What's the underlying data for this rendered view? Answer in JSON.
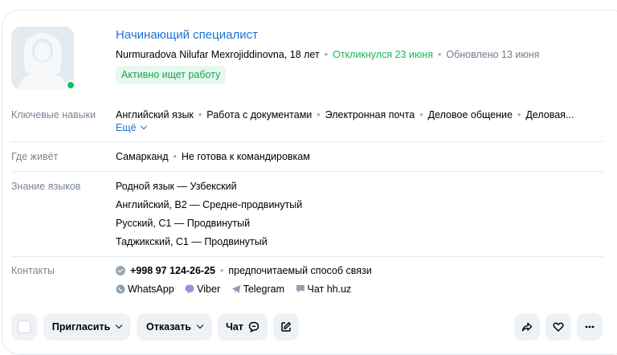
{
  "header": {
    "title": "Начинающий специалист",
    "name_age": "Nurmuradova Nilufar Mexrojiddinovna, 18 лет",
    "responded": "Откликнулся 23 июня",
    "updated": "Обновлено 13 июня",
    "status_badge": "Активно ищет работу"
  },
  "skills": {
    "label": "Ключевые навыки",
    "items": [
      "Английский язык",
      "Работа с документами",
      "Электронная почта",
      "Деловое общение",
      "Деловая..."
    ],
    "more_label": "Ещё"
  },
  "location": {
    "label": "Где живёт",
    "city": "Самарканд",
    "travel": "Не готова к командировкам"
  },
  "languages": {
    "label": "Знание языков",
    "items": [
      "Родной язык — Узбекский",
      "Английский, B2 — Средне-продвинутый",
      "Русский, C1 — Продвинутый",
      "Таджикский, C1 — Продвинутый"
    ]
  },
  "contacts": {
    "label": "Контакты",
    "phone": "+998 97 124-26-25",
    "preferred": "предпочитаемый способ связи",
    "messengers": [
      "WhatsApp",
      "Viber",
      "Telegram",
      "Чат hh.uz"
    ]
  },
  "actions": {
    "invite": "Пригласить",
    "reject": "Отказать",
    "chat": "Чат"
  },
  "colors": {
    "accent": "#1a73d9",
    "green": "#1cb35c",
    "online": "#0dc267"
  }
}
